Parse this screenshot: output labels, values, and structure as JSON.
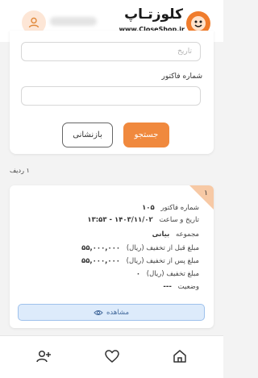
{
  "header": {
    "logo_text": "کلوزتـاپ",
    "logo_url": "www.CloseShop.ir",
    "avatar_icon": "user-icon"
  },
  "search_form": {
    "date_placeholder": "تاریخ",
    "invoice_label": "شماره فاکتور",
    "invoice_value": "",
    "search_button": "جستجو",
    "reset_button": "بازنشانی"
  },
  "results": {
    "row_count": "۱ ردیف",
    "items": [
      {
        "index": "۱",
        "invoice_number_label": "شماره فاکتور",
        "invoice_number": "۱۰۵",
        "datetime_label": "تاریخ و ساعت",
        "datetime": "۱۴۰۳/۱۱/۰۲ - ۱۳:۵۳",
        "collection_label": "مجموعه",
        "collection": "بیانی",
        "price_before_label": "مبلغ قبل از تخفیف (ریال)",
        "price_before": "۵۵,۰۰۰,۰۰۰",
        "price_after_label": "مبلغ پس از تخفیف (ریال)",
        "price_after": "۵۵,۰۰۰,۰۰۰",
        "discount_label": "مبلغ تخفیف (ریال)",
        "discount": "۰",
        "status_label": "وضعیت",
        "status": "---",
        "view_button": "مشاهده"
      }
    ]
  },
  "bottom_nav": {
    "items": [
      "home-icon",
      "heart-icon",
      "add-user-icon"
    ]
  },
  "colors": {
    "accent": "#f0893e",
    "corner": "#f7c9a5",
    "view_button_bg": "#ddebfb"
  }
}
